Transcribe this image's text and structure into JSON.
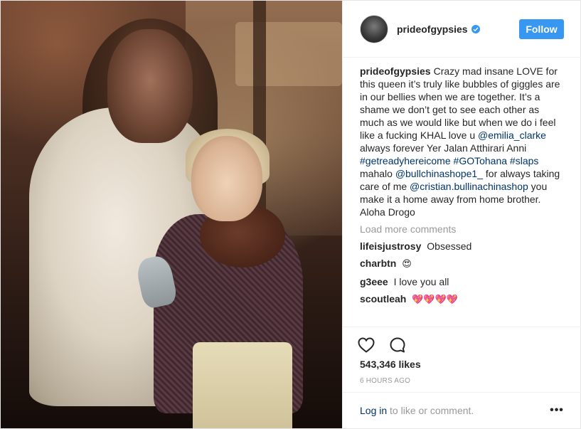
{
  "post": {
    "username": "prideofgypsies",
    "follow_label": "Follow",
    "caption": {
      "username": "prideofgypsies",
      "segments": [
        {
          "text": "Crazy mad insane LOVE for this queen it’s truly like bubbles of giggles are in our bellies when we are together. It’s a shame we don’t get to see each other as much as we would like but when we do i feel like a fucking KHAL love u ",
          "link": false
        },
        {
          "text": "@emilia_clarke",
          "link": true
        },
        {
          "text": " always forever Yer Jalan Atthirari Anni ",
          "link": false
        },
        {
          "text": "#getreadyhereicome",
          "link": true
        },
        {
          "text": " ",
          "link": false
        },
        {
          "text": "#GOTohana",
          "link": true
        },
        {
          "text": " ",
          "link": false
        },
        {
          "text": "#slaps",
          "link": true
        },
        {
          "text": " mahalo ",
          "link": false
        },
        {
          "text": "@bullchinashope1_",
          "link": true
        },
        {
          "text": " for always taking care of me ",
          "link": false
        },
        {
          "text": "@cristian.bullinachinashop",
          "link": true
        },
        {
          "text": " you make it a home away from home brother. Aloha Drogo",
          "link": false
        }
      ]
    },
    "load_more": "Load more comments",
    "comments": [
      {
        "username": "lifeisjustrosy",
        "text": "Obsessed"
      },
      {
        "username": "charbtn",
        "text": "😍"
      },
      {
        "username": "g3eee",
        "text": "I love you all"
      },
      {
        "username": "scoutleah",
        "text": "💖💖💖💖"
      }
    ],
    "likes": "543,346 likes",
    "timestamp": "6 HOURS AGO",
    "footer": {
      "login_label": "Log in",
      "rest": " to like or comment.",
      "more": "•••"
    }
  },
  "icons": {
    "avatar": "avatar",
    "verified": "verified-badge-icon",
    "like": "heart-icon",
    "comment": "comment-bubble-icon",
    "more": "more-options-icon"
  },
  "colors": {
    "accent": "#3897f0",
    "link": "#003569",
    "muted": "#999999",
    "text": "#262626"
  }
}
